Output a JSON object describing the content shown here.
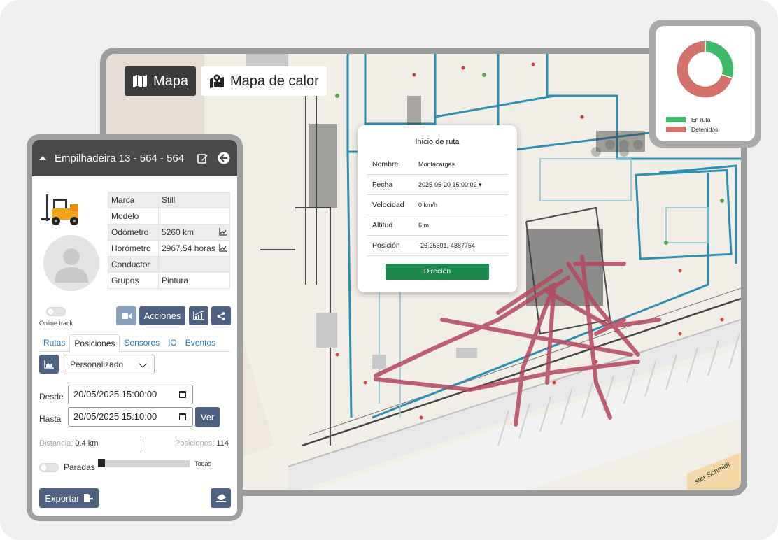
{
  "map": {
    "btn_map": "Mapa",
    "btn_heat": "Mapa de calor",
    "street_label": "ster Schmidt"
  },
  "popup": {
    "title": "Inicio de ruta",
    "rows": [
      {
        "key": "Nombre",
        "value": "Montacargas"
      },
      {
        "key": "Fecha",
        "value": "2025-05-20 15:00:02 ▾"
      },
      {
        "key": "Velocidad",
        "value": "0 km/h"
      },
      {
        "key": "Altitud",
        "value": "6 m"
      },
      {
        "key": "Posición",
        "value": "-26.25601,-4887754"
      }
    ],
    "button": "Direción"
  },
  "donut": {
    "legend": [
      {
        "label": "En ruta",
        "color": "#3fb96a"
      },
      {
        "label": "Detenidos",
        "color": "#d4736d"
      }
    ],
    "fractions": [
      0.3,
      0.7
    ]
  },
  "panel": {
    "title": "Empilhadeira 13 - 564 - 564",
    "info": [
      {
        "key": "Marca",
        "value": "Still",
        "chart": false
      },
      {
        "key": "Modelo",
        "value": "",
        "chart": false
      },
      {
        "key": "Odómetro",
        "value": "5260 km",
        "chart": true
      },
      {
        "key": "Horómetro",
        "value": "2967.54 horas",
        "chart": true
      },
      {
        "key": "Conductor",
        "value": "",
        "chart": false
      },
      {
        "key": "Grupos",
        "value": "Pintura",
        "chart": false
      }
    ],
    "online_track": "Online track",
    "acciones": "Acciones",
    "tabs": [
      "Rutas",
      "Posiciones",
      "Sensores",
      "IO",
      "Eventos"
    ],
    "active_tab": "Posiciones",
    "period": "Personalizado",
    "desde_label": "Desde",
    "hasta_label": "Hasta",
    "desde_value": "20/05/2025 15:00:00",
    "hasta_value": "20/05/2025 15:10:00",
    "ver": "Ver",
    "distance_label": "Distancia:",
    "distance_value": "0.4 km",
    "positions_label": "Posiciones:",
    "positions_value": "114",
    "paradas": "Paradas",
    "todas": "Todas",
    "exportar": "Exportar"
  },
  "colors": {
    "header": "#4a4a4a",
    "button": "#4e6180",
    "route": "#b5475f",
    "popup_button": "#1c8a4c"
  }
}
